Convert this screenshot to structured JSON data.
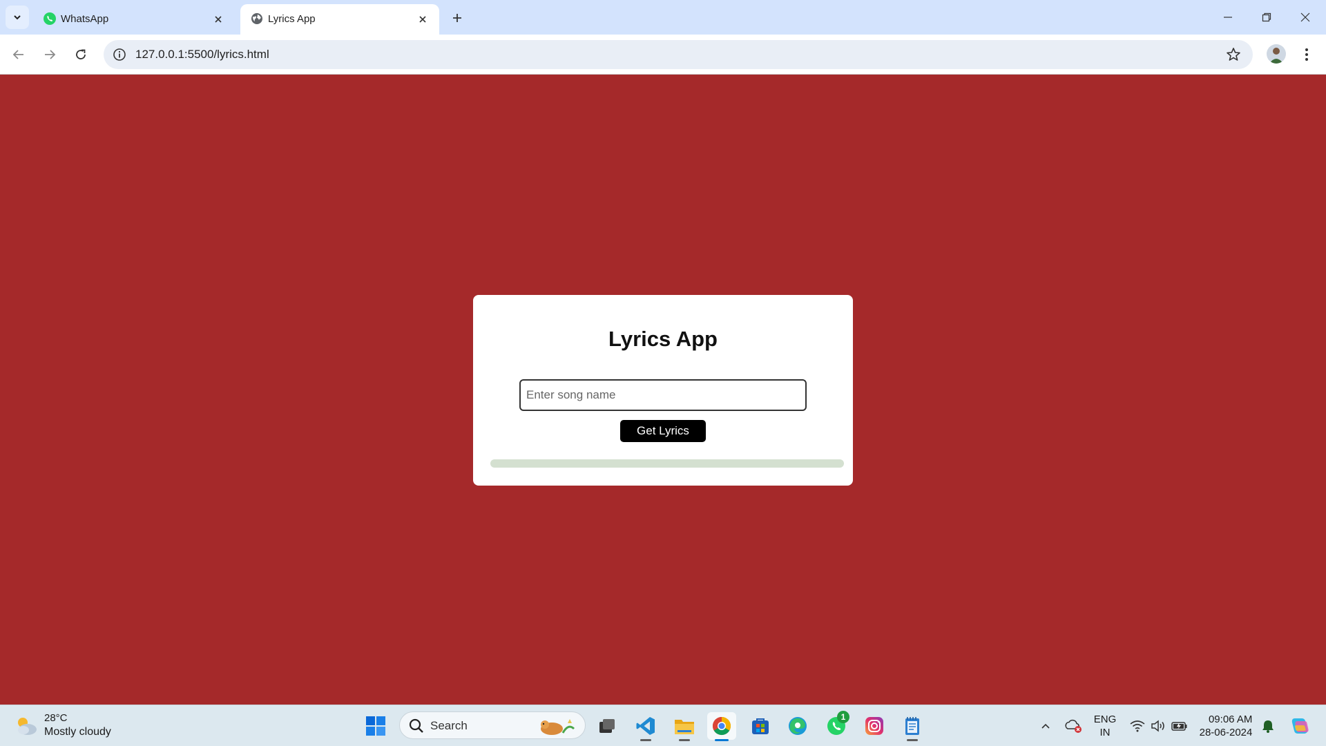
{
  "browser": {
    "tabs": [
      {
        "title": "WhatsApp",
        "icon": "whatsapp-icon",
        "active": false
      },
      {
        "title": "Lyrics App",
        "icon": "globe-icon",
        "active": true
      }
    ],
    "url": "127.0.0.1:5500/lyrics.html"
  },
  "app": {
    "title": "Lyrics App",
    "input_placeholder": "Enter song name",
    "input_value": "",
    "button_label": "Get Lyrics",
    "background_color": "#a5292a",
    "lyrics_area_color": "#d4e0d0"
  },
  "taskbar": {
    "weather": {
      "temp": "28°C",
      "condition": "Mostly cloudy"
    },
    "search_label": "Search",
    "apps": [
      "windows-start-icon",
      "task-view-icon",
      "vscode-icon",
      "file-explorer-icon",
      "chrome-icon",
      "store-icon",
      "edge-icon",
      "whatsapp-icon",
      "instagram-icon",
      "notepad-icon"
    ],
    "whatsapp_badge": "1",
    "language": {
      "line1": "ENG",
      "line2": "IN"
    },
    "time": "09:06 AM",
    "date": "28-06-2024"
  }
}
